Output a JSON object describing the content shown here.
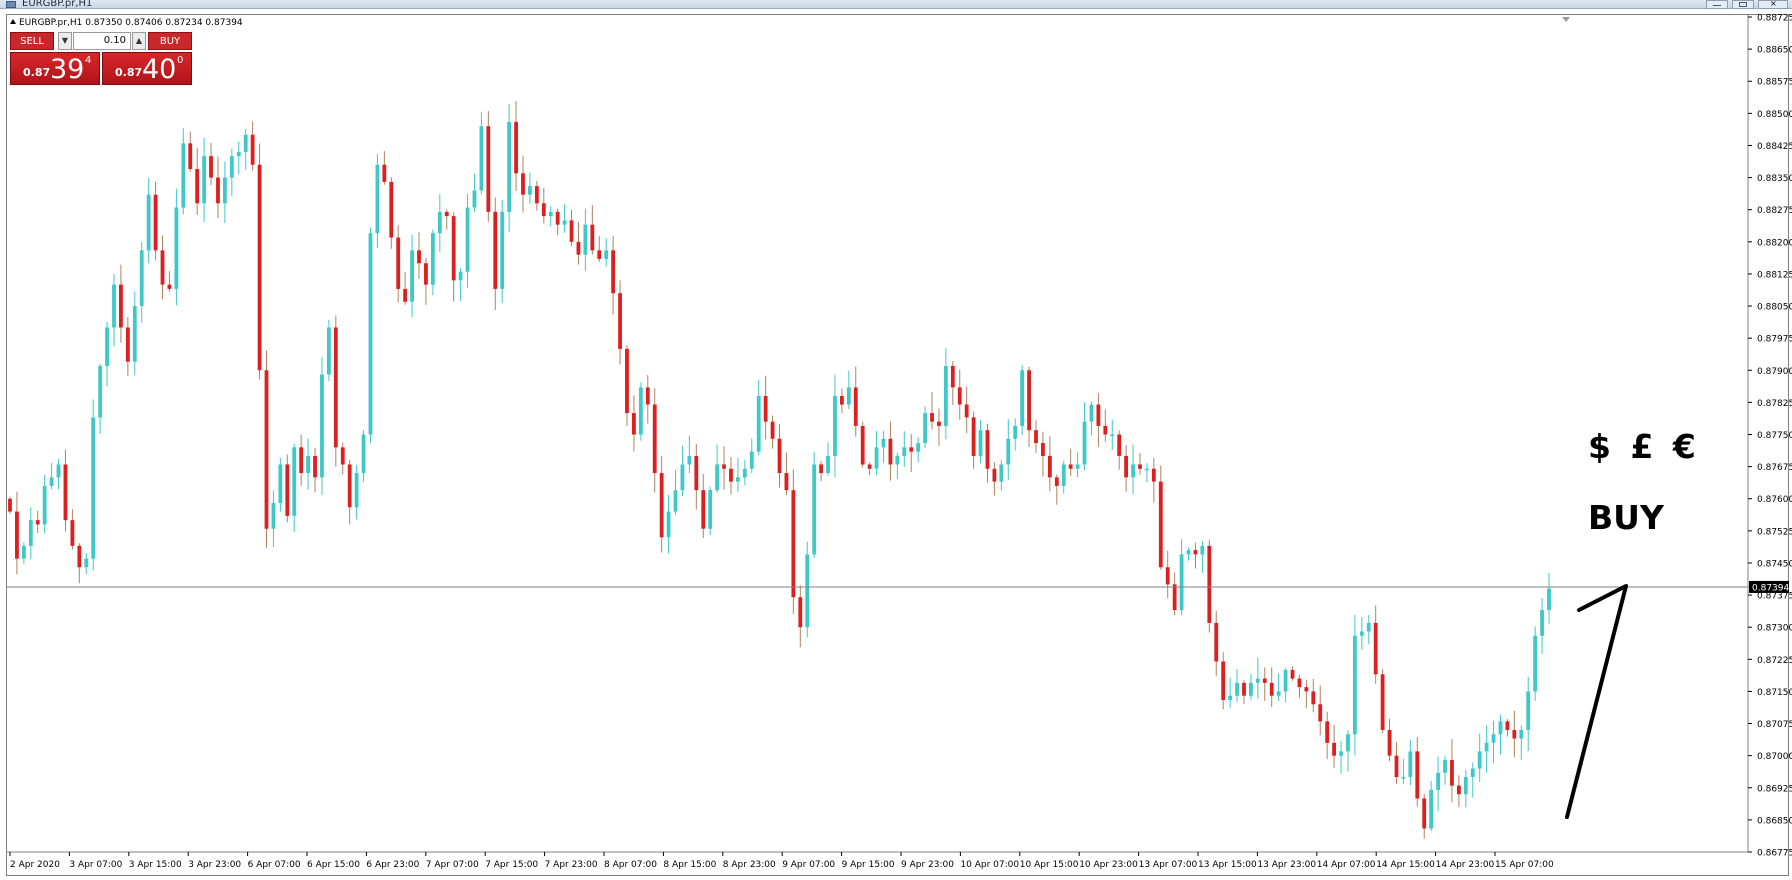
{
  "window": {
    "title": "EURGBP.pr,H1"
  },
  "chart_info": {
    "symbol_line": "EURGBP.pr,H1  0.87350 0.87406 0.87234 0.87394"
  },
  "trade_panel": {
    "sell_label": "SELL",
    "buy_label": "BUY",
    "volume": "0.10",
    "sell_price_prefix": "0.87",
    "sell_price_big": "39",
    "sell_price_sup": "4",
    "buy_price_prefix": "0.87",
    "buy_price_big": "40",
    "buy_price_sup": "0"
  },
  "colors": {
    "bull": "#3fc8c8",
    "bear": "#dc1f1f",
    "bear_wick": "#b08060",
    "grid_line": "#808080",
    "price_tag_bg": "#000000"
  },
  "annotations": {
    "currencies": "$ £ €",
    "buy": "BUY"
  },
  "chart_data": {
    "type": "candlestick",
    "current_price": 0.87394,
    "current_price_label": "0.87394",
    "y_ticks": [
      "0.88725",
      "0.88650",
      "0.88575",
      "0.88500",
      "0.88425",
      "0.88350",
      "0.88275",
      "0.88200",
      "0.88125",
      "0.88050",
      "0.87975",
      "0.87900",
      "0.87825",
      "0.87750",
      "0.87675",
      "0.87600",
      "0.87525",
      "0.87450",
      "0.87375",
      "0.87300",
      "0.87225",
      "0.87150",
      "0.87075",
      "0.87000",
      "0.86925",
      "0.86850",
      "0.86775"
    ],
    "ylim": [
      0.86775,
      0.88725
    ],
    "x_ticks": [
      "2 Apr 2020",
      "3 Apr 07:00",
      "3 Apr 15:00",
      "3 Apr 23:00",
      "6 Apr 07:00",
      "6 Apr 15:00",
      "6 Apr 23:00",
      "7 Apr 07:00",
      "7 Apr 15:00",
      "7 Apr 23:00",
      "8 Apr 07:00",
      "8 Apr 15:00",
      "8 Apr 23:00",
      "9 Apr 07:00",
      "9 Apr 15:00",
      "9 Apr 23:00",
      "10 Apr 07:00",
      "10 Apr 15:00",
      "10 Apr 23:00",
      "13 Apr 07:00",
      "13 Apr 15:00",
      "13 Apr 23:00",
      "14 Apr 07:00",
      "14 Apr 15:00",
      "14 Apr 23:00",
      "15 Apr 07:00"
    ],
    "closes": [
      0.8757,
      0.8746,
      0.8749,
      0.8755,
      0.8754,
      0.8763,
      0.8765,
      0.8768,
      0.8755,
      0.8749,
      0.8744,
      0.8746,
      0.8779,
      0.8791,
      0.88,
      0.881,
      0.88,
      0.8792,
      0.8805,
      0.8818,
      0.8831,
      0.8818,
      0.881,
      0.8809,
      0.8828,
      0.8843,
      0.8837,
      0.8829,
      0.884,
      0.8835,
      0.8829,
      0.8835,
      0.884,
      0.8841,
      0.8845,
      0.8838,
      0.879,
      0.8753,
      0.8759,
      0.8768,
      0.8756,
      0.8772,
      0.8766,
      0.877,
      0.8765,
      0.8789,
      0.88,
      0.8772,
      0.8768,
      0.8758,
      0.8766,
      0.8775,
      0.8822,
      0.8838,
      0.8834,
      0.8821,
      0.8809,
      0.8806,
      0.8818,
      0.8815,
      0.881,
      0.8822,
      0.8827,
      0.8826,
      0.8811,
      0.8813,
      0.8828,
      0.8832,
      0.8847,
      0.8827,
      0.8809,
      0.8827,
      0.8848,
      0.8836,
      0.8831,
      0.8833,
      0.8829,
      0.8826,
      0.8827,
      0.8824,
      0.8825,
      0.882,
      0.8817,
      0.8824,
      0.8818,
      0.8816,
      0.8818,
      0.8808,
      0.8795,
      0.878,
      0.8775,
      0.8786,
      0.8782,
      0.8766,
      0.8751,
      0.8757,
      0.8762,
      0.8768,
      0.877,
      0.8762,
      0.8753,
      0.8762,
      0.8768,
      0.8767,
      0.8764,
      0.8765,
      0.8767,
      0.8771,
      0.8784,
      0.8778,
      0.8774,
      0.8766,
      0.8762,
      0.8737,
      0.873,
      0.8747,
      0.8768,
      0.8766,
      0.877,
      0.8784,
      0.8782,
      0.8786,
      0.8777,
      0.8768,
      0.8767,
      0.8772,
      0.8774,
      0.8768,
      0.877,
      0.8772,
      0.8771,
      0.8773,
      0.878,
      0.8778,
      0.8777,
      0.8791,
      0.8786,
      0.8782,
      0.8779,
      0.877,
      0.8776,
      0.8767,
      0.8764,
      0.8768,
      0.8774,
      0.8777,
      0.879,
      0.8776,
      0.8773,
      0.877,
      0.8765,
      0.8763,
      0.8768,
      0.8767,
      0.8768,
      0.8778,
      0.8782,
      0.8777,
      0.8775,
      0.8775,
      0.877,
      0.8765,
      0.8768,
      0.8767,
      0.8767,
      0.8764,
      0.8744,
      0.874,
      0.8734,
      0.8747,
      0.8748,
      0.8747,
      0.8749,
      0.8731,
      0.8722,
      0.8713,
      0.8714,
      0.8717,
      0.8714,
      0.8717,
      0.8718,
      0.8717,
      0.8714,
      0.8715,
      0.872,
      0.8718,
      0.8716,
      0.8715,
      0.8712,
      0.8708,
      0.8703,
      0.87,
      0.8701,
      0.8705,
      0.8728,
      0.8729,
      0.8731,
      0.8719,
      0.8706,
      0.87,
      0.8695,
      0.8695,
      0.8701,
      0.869,
      0.8683,
      0.8692,
      0.8696,
      0.8699,
      0.8693,
      0.8691,
      0.8695,
      0.8697,
      0.8701,
      0.8703,
      0.8705,
      0.8708,
      0.8706,
      0.8704,
      0.8706,
      0.8715,
      0.8728,
      0.8734,
      0.8739
    ]
  }
}
